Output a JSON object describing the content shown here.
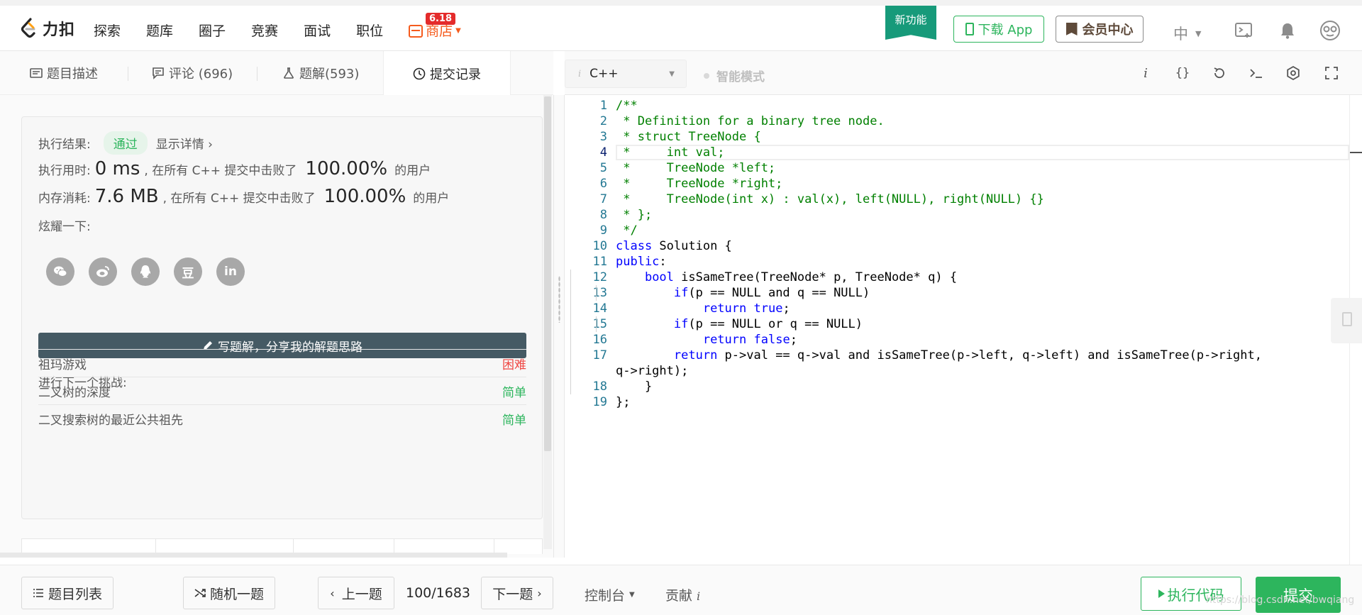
{
  "nav": {
    "logo_text": "力扣",
    "links": [
      "探索",
      "题库",
      "圈子",
      "竞赛",
      "面试",
      "职位"
    ],
    "shop_label": "商店",
    "shop_badge": "6.18",
    "new_feature": "新功能",
    "download_app": "下载 App",
    "vip_center": "会员中心",
    "language": "中"
  },
  "tabs": {
    "description": "题目描述",
    "comments": "评论 (696)",
    "solutions": "题解(593)",
    "submissions": "提交记录"
  },
  "result": {
    "status_label": "执行结果:",
    "status_value": "通过",
    "detail_link": "显示详情 ›",
    "time_label": "执行用时:",
    "time_value": "0 ms",
    "time_mid": ", 在所有 C++ 提交中击败了",
    "time_pct": "100.00%",
    "time_tail": "的用户",
    "mem_label": "内存消耗:",
    "mem_value": "7.6 MB",
    "mem_mid": ", 在所有 C++ 提交中击败了",
    "mem_pct": "100.00%",
    "mem_tail": "的用户",
    "share_label": "炫耀一下:",
    "share_icons": [
      "wechat-icon",
      "weibo-icon",
      "qq-icon",
      "douban-icon",
      "linkedin-icon"
    ],
    "douban_glyph": "豆",
    "linkedin_glyph": "in",
    "write_solution": "写题解，分享我的解题思路",
    "next_challenge": "进行下一个挑战:",
    "problems": [
      {
        "title": "祖玛游戏",
        "difficulty": "困难"
      },
      {
        "title": "二叉树的深度",
        "difficulty": "简单"
      },
      {
        "title": "二叉搜索树的最近公共祖先",
        "difficulty": "简单"
      }
    ]
  },
  "editor": {
    "language": "C++",
    "smart_mode": "智能模式",
    "current_line": 4,
    "lines": [
      "/**",
      " * Definition for a binary tree node.",
      " * struct TreeNode {",
      " *     int val;",
      " *     TreeNode *left;",
      " *     TreeNode *right;",
      " *     TreeNode(int x) : val(x), left(NULL), right(NULL) {}",
      " * };",
      " */",
      "class Solution {",
      "public:",
      "    bool isSameTree(TreeNode* p, TreeNode* q) {",
      "        if(p == NULL and q == NULL)",
      "            return true;",
      "        if(p == NULL or q == NULL)",
      "            return false;",
      "        return p->val == q->val and isSameTree(p->left, q->left) and isSameTree(p->right,",
      "q->right);",
      "    }",
      "};"
    ],
    "line_numbers": [
      "1",
      "2",
      "3",
      "4",
      "5",
      "6",
      "7",
      "8",
      "9",
      "10",
      "11",
      "12",
      "13",
      "14",
      "15",
      "16",
      "17",
      "",
      "18",
      "19"
    ]
  },
  "bottom": {
    "problem_list": "题目列表",
    "random": "随机一题",
    "prev": "上一题",
    "page": "100/1683",
    "next": "下一题",
    "console": "控制台",
    "contribute": "贡献",
    "contribute_icon": "i",
    "run_code": "执行代码",
    "submit": "提交"
  },
  "watermark": "https://blog.csdn.net/bwqiang",
  "colors": {
    "green": "#2db55d",
    "red": "#ef4743",
    "shop": "#f55b1d",
    "badge": "#e42b2b",
    "new_feature": "#179a7a",
    "write_btn": "#455a64"
  }
}
